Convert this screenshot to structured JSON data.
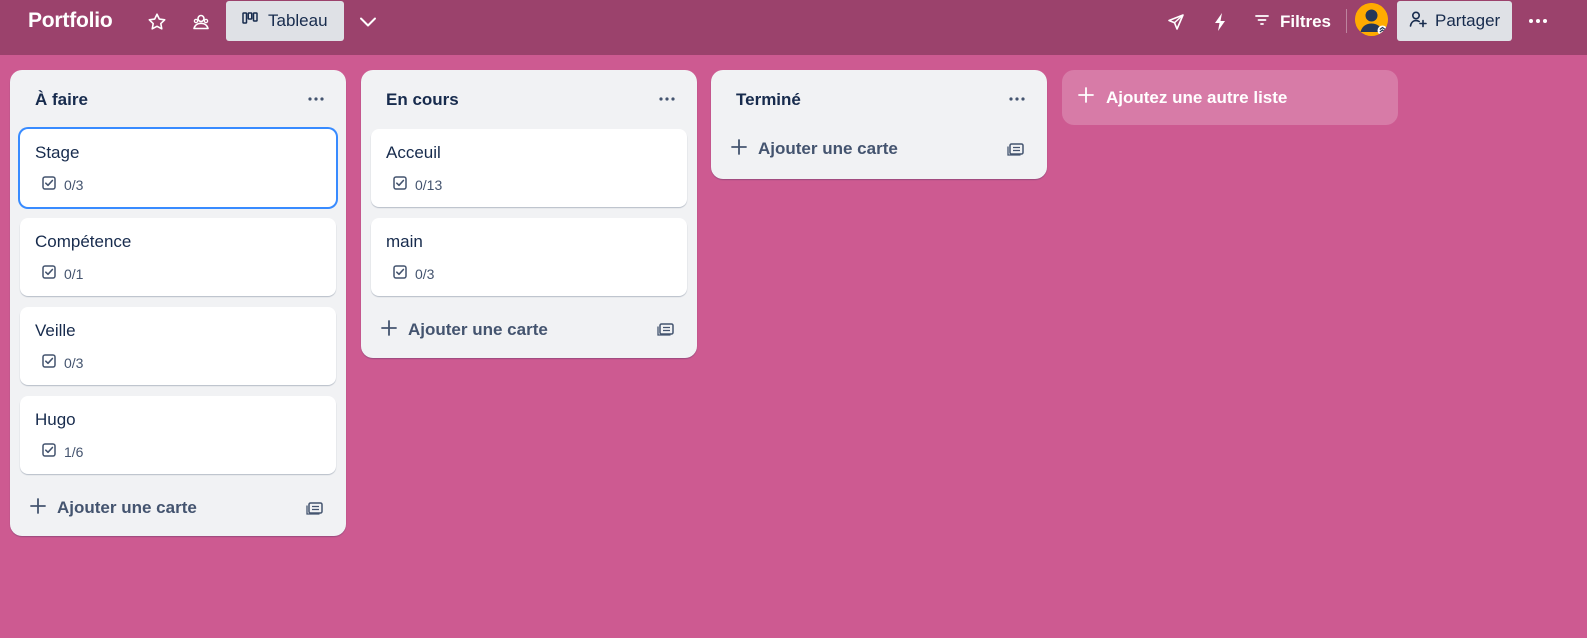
{
  "header": {
    "board_title": "Portfolio",
    "view_label": "Tableau",
    "filter_label": "Filtres",
    "share_label": "Partager",
    "icons": [
      "star-icon",
      "workspace-visibility-icon",
      "board-icon",
      "chevron-down-icon",
      "power-ups-icon",
      "automation-icon",
      "filter-icon",
      "share-icon",
      "more-icon"
    ]
  },
  "lists": [
    {
      "title": "À faire",
      "cards": [
        {
          "title": "Stage",
          "checklist": "0/3"
        },
        {
          "title": "Compétence",
          "checklist": "0/1"
        },
        {
          "title": "Veille",
          "checklist": "0/3"
        },
        {
          "title": "Hugo",
          "checklist": "1/6"
        }
      ],
      "add_card_label": "Ajouter une carte"
    },
    {
      "title": "En cours",
      "cards": [
        {
          "title": "Acceuil",
          "checklist": "0/13"
        },
        {
          "title": "main",
          "checklist": "0/3"
        }
      ],
      "add_card_label": "Ajouter une carte"
    },
    {
      "title": "Terminé",
      "cards": [],
      "add_card_label": "Ajouter une carte"
    }
  ],
  "add_list_label": "Ajoutez une autre liste",
  "colors": {
    "board_background": "#cd5a91",
    "header_background": "#9b426c",
    "list_background": "#f1f2f4",
    "focus_ring": "#388bff",
    "avatar": "#ffab00"
  }
}
